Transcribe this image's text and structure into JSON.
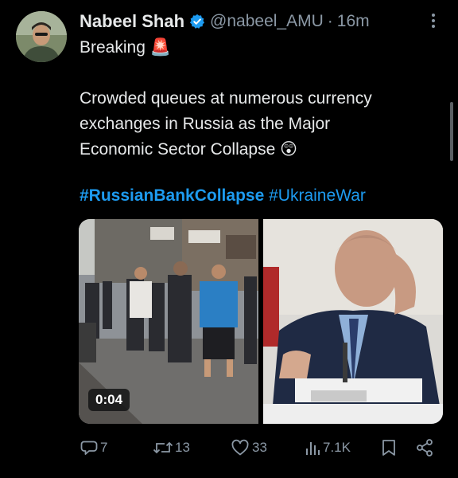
{
  "tweet": {
    "author_name": "Nabeel Shah",
    "handle": "@nabeel_AMU",
    "separator": "·",
    "time_ago": "16m",
    "text_lines": [
      "Breaking 🚨",
      "",
      "Crowded queues at numerous currency",
      "exchanges in Russia as the Major",
      "Economic Sector Collapse 😲"
    ],
    "hashtags": [
      "#RussianBankCollapse",
      "#UkraineWar"
    ],
    "video_duration": "0:04"
  },
  "actions": {
    "replies": "7",
    "retweets": "13",
    "likes": "33",
    "views": "7.1K"
  },
  "colors": {
    "background": "#000000",
    "text": "#e7e9ea",
    "secondary": "#8b98a5",
    "link": "#1d9bf0",
    "verified": "#1d9bf0"
  }
}
